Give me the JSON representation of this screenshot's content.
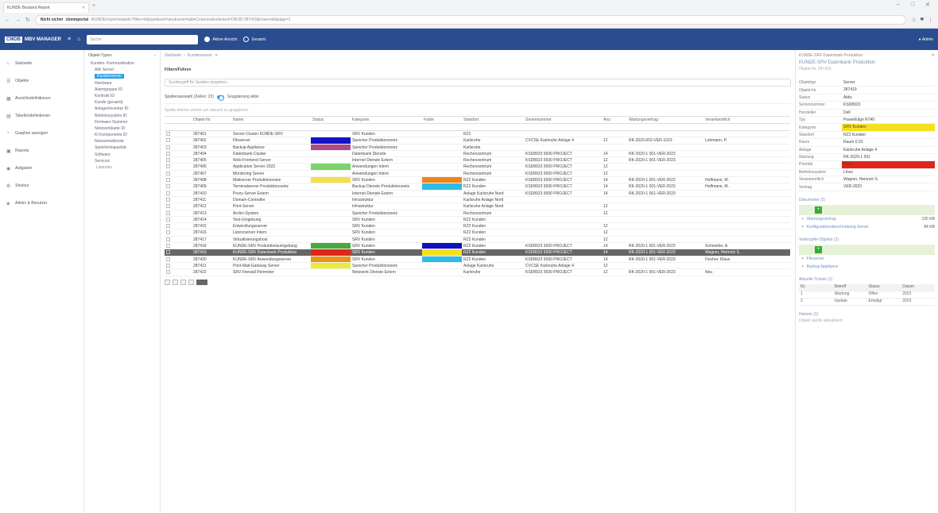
{
  "browser": {
    "tab_title": "KUNDE Bestand Report",
    "url_prefix": "Nicht sicher",
    "url_domain": "cbmmportal",
    "url_rest": "/KUNDE/report/statistic?filter=objtype&sort=asc&view=tableColumns&selected=OBJID:287415&rows=all&page=1"
  },
  "app": {
    "brand": "CMDB",
    "title": "MBV MANAGER",
    "search_placeholder": "Suche",
    "radio1": "Aktive Ansicht",
    "radio2": "Gesamt",
    "user_label": "Admin"
  },
  "nav": [
    {
      "icon": "home-icon",
      "label": "Startseite"
    },
    {
      "icon": "list-icon",
      "label": "Objekte"
    },
    {
      "icon": "grid-icon",
      "label": "Ansichtsdefinitionen"
    },
    {
      "icon": "table-icon",
      "label": "Tabellendefinitionen"
    },
    {
      "icon": "chart-icon",
      "label": "Graphen anzeigen"
    },
    {
      "icon": "report-icon",
      "label": "Reports"
    },
    {
      "icon": "bell-icon",
      "label": "Aufgaben"
    },
    {
      "icon": "gear-icon",
      "label": "Struktur"
    },
    {
      "icon": "admin-icon",
      "label": "Admin & Benutzer"
    }
  ],
  "tree": {
    "header": "Objekt-Typen",
    "items": [
      "Kunden- Kommunikation",
      "Alle Server",
      "Kundenserver",
      "Hardware",
      "Alarmgruppe ID",
      "Kontrakt ID",
      "Kunde (gesamt)",
      "Anlageninventar ID",
      "Betriebssystem ID",
      "Firmware Nummer",
      "Netzwerkkarte ID",
      "KI Komponente ID",
      "Netzwerkdienste",
      "Speicherkapazität",
      "Software",
      "Services",
      "Lizenzen"
    ],
    "selected_index": 2
  },
  "content": {
    "breadcrumb": [
      "Startseite",
      "Kundenserver"
    ],
    "filter_title": "Filtern/Führen",
    "filter_placeholder": "Suchbegriff für Spalten eingeben...",
    "view_label": "Spaltenauswahl (Zeilen: 22)",
    "view_toggle_label": "Gruppierung aktiv",
    "hint": "Spalte hierher ziehen um danach zu gruppieren",
    "columns": [
      "",
      "",
      "Objekt-Nr.",
      "Name",
      "Status",
      "Kategorie",
      "Farbe",
      "Standort",
      "Seriennummer",
      "Anz.",
      "Wartungsvertrag",
      "Verantwortlich",
      ""
    ],
    "filter_row": [
      "",
      "",
      "",
      "",
      "",
      "",
      "",
      "",
      "",
      "",
      "",
      "",
      ""
    ]
  },
  "rows": [
    {
      "id": "287401",
      "name": "Server-Cluster KUNDE-SRV",
      "status": "",
      "cat": "SRV Kunden",
      "swatch": "",
      "loc": "RZ1",
      "serial": "",
      "n": "",
      "contract": "",
      "owner": ""
    },
    {
      "id": "287402",
      "name": "Fileserver",
      "status": "#1212c8",
      "cat": "Speicher Produktionsnetz",
      "swatch": "",
      "loc": "Karlsruhe",
      "serial": "CVCSE Karlsruhe Anlage 4",
      "n": "12",
      "contract": "RK-2020-002-VER-1023",
      "owner": "Lehmann, P."
    },
    {
      "id": "287403",
      "name": "Backup Appliance",
      "status": "#b04a8a",
      "cat": "Speicher Produktionsnetz",
      "swatch": "",
      "loc": "Karlsruhe",
      "serial": "",
      "n": "",
      "contract": "",
      "owner": ""
    },
    {
      "id": "287404",
      "name": "Datenbank-Cluster",
      "status": "",
      "cat": "Datenbank Dienste",
      "swatch": "",
      "loc": "Rechenzentrum",
      "serial": "KSD8923 9930 PROJECT",
      "n": "14",
      "contract": "RK-2020-1 001-VER-2023",
      "owner": ""
    },
    {
      "id": "287405",
      "name": "Web-Frontend Server",
      "status": "",
      "cat": "Internet Dienste Extern",
      "swatch": "",
      "loc": "Rechenzentrum",
      "serial": "KSD8923 9930 PROJECT",
      "n": "12",
      "contract": "RK-2020-1 001-VER-2023",
      "owner": ""
    },
    {
      "id": "287406",
      "name": "Application Server 2023",
      "status": "#7bd36a",
      "cat": "Anwendungen Intern",
      "swatch": "",
      "loc": "Rechenzentrum",
      "serial": "KSD8923 9930 PROJECT",
      "n": "12",
      "contract": "",
      "owner": ""
    },
    {
      "id": "287407",
      "name": "Monitoring Server",
      "status": "",
      "cat": "Anwendungen Intern",
      "swatch": "",
      "loc": "Rechenzentrum",
      "serial": "KSD8923 9930 PROJECT",
      "n": "12",
      "contract": "",
      "owner": ""
    },
    {
      "id": "287408",
      "name": "Mailserver Produktionsnetz",
      "status": "#f4e14a",
      "cat": "SRV Kunden",
      "swatch": "#f0851a",
      "loc": "RZ2 Kunden",
      "serial": "KSD8923 9930 PROJECT",
      "n": "14",
      "contract": "RK-2020-1 001-VER-2023",
      "owner": "Hoffmann, M."
    },
    {
      "id": "287409",
      "name": "Terminalserver Produktionsnetz",
      "status": "",
      "cat": "Backup Dienste Produktionsnetz",
      "swatch": "#2dbde4",
      "loc": "RZ2 Kunden",
      "serial": "KSD8923 9930 PROJECT",
      "n": "14",
      "contract": "RK-2020-1 001-VER-2023",
      "owner": "Hoffmann, M."
    },
    {
      "id": "287410",
      "name": "Proxy-Server Extern",
      "status": "",
      "cat": "Internet Dienste Extern",
      "swatch": "",
      "loc": "Anlage Karlsruhe Nord",
      "serial": "KSD8923 9930 PROJECT",
      "n": "14",
      "contract": "RK-2020-1 001-VER-2023",
      "owner": ""
    },
    {
      "id": "287411",
      "name": "Domain-Controller",
      "status": "",
      "cat": "Infrastruktur",
      "swatch": "",
      "loc": "Karlsruhe Anlage Nord",
      "serial": "",
      "n": "",
      "contract": "",
      "owner": ""
    },
    {
      "id": "287412",
      "name": "Print-Server",
      "status": "",
      "cat": "Infrastruktur",
      "swatch": "",
      "loc": "Karlsruhe Anlage Nord",
      "serial": "",
      "n": "12",
      "contract": "",
      "owner": ""
    },
    {
      "id": "287413",
      "name": "Archiv-System",
      "status": "",
      "cat": "Speicher Produktionsnetz",
      "swatch": "",
      "loc": "Rechenzentrum",
      "serial": "",
      "n": "12",
      "contract": "",
      "owner": ""
    },
    {
      "id": "287414",
      "name": "Test-Umgebung",
      "status": "",
      "cat": "SRV Kunden",
      "swatch": "",
      "loc": "RZ2 Kunden",
      "serial": "",
      "n": "",
      "contract": "",
      "owner": ""
    },
    {
      "id": "287415",
      "name": "Entwicklungsserver",
      "status": "",
      "cat": "SRV Kunden",
      "swatch": "",
      "loc": "RZ2 Kunden",
      "serial": "",
      "n": "12",
      "contract": "",
      "owner": ""
    },
    {
      "id": "287416",
      "name": "Lizenzserver Intern",
      "status": "",
      "cat": "SRV Kunden",
      "swatch": "",
      "loc": "RZ2 Kunden",
      "serial": "",
      "n": "12",
      "contract": "",
      "owner": ""
    },
    {
      "id": "287417",
      "name": "Virtualisierungshost",
      "status": "",
      "cat": "SRV Kunden",
      "swatch": "",
      "loc": "RZ2 Kunden",
      "serial": "",
      "n": "12",
      "contract": "",
      "owner": ""
    },
    {
      "id": "287418",
      "name": "KUNDE-SRV Produktionsumgebung",
      "status": "#4aa838",
      "cat": "SRV Kunden",
      "swatch": "#1010c0",
      "loc": "RZ2 Kunden",
      "serial": "KSD8923 9930 PROJECT",
      "n": "14",
      "contract": "RK-2020-1 001-VER-2023",
      "owner": "Schneider, A."
    },
    {
      "id": "287419",
      "name": "KUNDE-SRV Datenbank Produktion",
      "status": "#e0261a",
      "cat": "SRV Kunden",
      "swatch": "#f5e020",
      "loc": "RZ2 Kunden",
      "serial": "KSD8923 9930 PROJECT",
      "n": "14",
      "contract": "RK-2020-1 001-VER-2023",
      "owner": "Wagner, Heinrich S.",
      "hl": true
    },
    {
      "id": "287420",
      "name": "KUNDE-SRV Anwendungsserver",
      "status": "#e79418",
      "cat": "SRV Kunden",
      "swatch": "#2dbde4",
      "loc": "RZ2 Kunden",
      "serial": "KSD8923 9930 PROJECT",
      "n": "14",
      "contract": "RK-2020-1 001-VER-2023",
      "owner": "Fischer, Klaus"
    },
    {
      "id": "287421",
      "name": "Print-Mail-Gateway Server",
      "status": "#eaea38",
      "cat": "Speicher Produktionsnetz",
      "swatch": "",
      "loc": "Anlage Karlsruhe",
      "serial": "CVCSE Karlsruhe Anlage 4",
      "n": "12",
      "contract": "",
      "owner": ""
    },
    {
      "id": "287422",
      "name": "SRV-Firewall Perimeter",
      "status": "",
      "cat": "Netzwerk Dienste Extern",
      "swatch": "",
      "loc": "Karlsruhe",
      "serial": "KSD8923 9930 PROJECT",
      "n": "12",
      "contract": "RK-2020-1 001-VER-2023",
      "owner": "Neu"
    }
  ],
  "side": {
    "header": "KUNDE-SRV Datenbank Produktion",
    "title": "KUNDE-SRV Datenbank Produktion",
    "subtitle": "Objekt-Nr. 287419",
    "props": [
      {
        "k": "Objekttyp",
        "v": "Server"
      },
      {
        "k": "Objekt-Nr.",
        "v": "287419"
      },
      {
        "k": "Status",
        "v": "Aktiv"
      },
      {
        "k": "Seriennummer",
        "v": "KSD8923"
      },
      {
        "k": "Hersteller",
        "v": "Dell"
      },
      {
        "k": "Typ",
        "v": "PowerEdge R740"
      },
      {
        "k": "Kategorie",
        "v": "SRV Kunden",
        "color": "#f5e020"
      },
      {
        "k": "Standort",
        "v": "RZ2 Kunden"
      },
      {
        "k": "Raum",
        "v": "Raum 0.23"
      },
      {
        "k": "Anlage",
        "v": "Karlsruhe Anlage 4"
      },
      {
        "k": "Wartung",
        "v": "RK-2020-1 001"
      },
      {
        "k": "Priorität",
        "v": "Hoch",
        "color": "#e0261a"
      },
      {
        "k": "Betriebssystem",
        "v": "Linux"
      },
      {
        "k": "Verantwortlich",
        "v": "Wagner, Heinrich S."
      },
      {
        "k": "Vertrag",
        "v": "VER-2023"
      }
    ],
    "sec1": "Dokumente (2)",
    "rel1": [
      {
        "name": "Wartungsvertrag",
        "size": "120 KB"
      },
      {
        "name": "Konfigurationsbeschreibung Server",
        "size": "84 KB"
      }
    ],
    "sec2": "Verknüpfte Objekte (2)",
    "rel2": [
      "Fileserver",
      "Backup Appliance"
    ],
    "sec3": "Aktuelle Tickets (1)",
    "tbl_head": [
      "Nr.",
      "Betreff",
      "Status",
      "Datum"
    ],
    "tbl_rows": [
      [
        "1",
        "Wartung",
        "Offen",
        "2023"
      ],
      [
        "2",
        "Update",
        "Erledigt",
        "2023"
      ]
    ],
    "sec4": "Historie (1)",
    "hist": "Objekt wurde aktualisiert"
  }
}
